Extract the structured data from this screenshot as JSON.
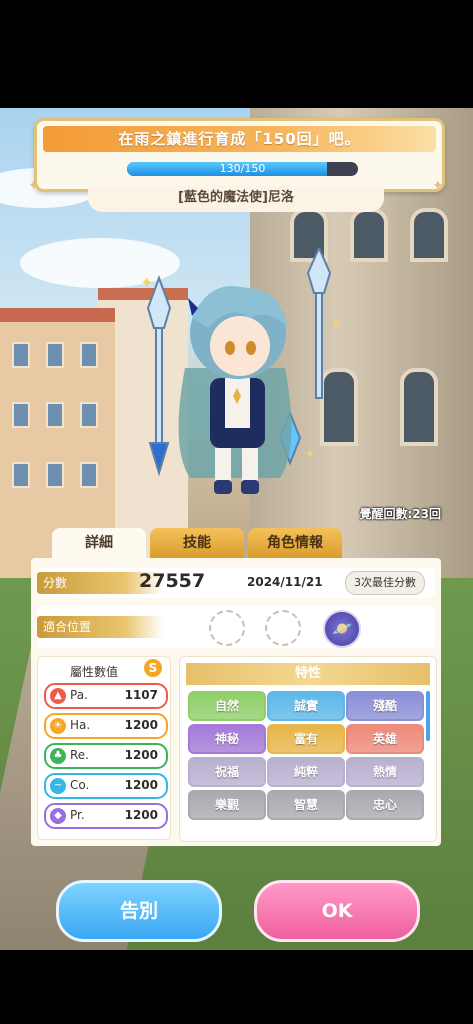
{
  "banner": {
    "goal_text": "在雨之鎮進行育成「150回」吧。",
    "progress_text": "130/150",
    "progress_value": 130,
    "progress_max": 150
  },
  "character": {
    "title": "[藍色的魔法使]尼洛",
    "awakening_text": "覺醒回數:23回"
  },
  "tabs": [
    {
      "label": "詳細"
    },
    {
      "label": "技能"
    },
    {
      "label": "角色情報"
    }
  ],
  "details": {
    "score_label": "分數",
    "score_value": "27557",
    "date": "2024/11/21",
    "best_score_button": "3次最佳分數",
    "position_label": "適合位置"
  },
  "attributes": {
    "title": "屬性數值",
    "badge": "S",
    "stats": [
      {
        "name": "Pa.",
        "value": "1107",
        "icon": "fire-icon",
        "color": "#ef5b4a"
      },
      {
        "name": "Ha.",
        "value": "1200",
        "icon": "sun-icon",
        "color": "#f5a623"
      },
      {
        "name": "Re.",
        "value": "1200",
        "icon": "clover-icon",
        "color": "#3cb55a"
      },
      {
        "name": "Co.",
        "value": "1200",
        "icon": "wave-icon",
        "color": "#35b6e8"
      },
      {
        "name": "Pr.",
        "value": "1200",
        "icon": "diamond-icon",
        "color": "#9b6ee0"
      }
    ]
  },
  "traits": {
    "title": "特性",
    "items": [
      {
        "label": "自然",
        "color": "#8fcf6a"
      },
      {
        "label": "誠實",
        "color": "#5db8e8"
      },
      {
        "label": "殘酷",
        "color": "#8b8fd6"
      },
      {
        "label": "神秘",
        "color": "#a57ad8"
      },
      {
        "label": "富有",
        "color": "#e8b54a"
      },
      {
        "label": "英雄",
        "color": "#ee8a7a"
      },
      {
        "label": "祝福",
        "color": "#b9b0cf"
      },
      {
        "label": "純粹",
        "color": "#b9b0cf"
      },
      {
        "label": "熱情",
        "color": "#b9b0cf"
      },
      {
        "label": "樂觀",
        "color": "#a9a9b0"
      },
      {
        "label": "智慧",
        "color": "#a9a9b0"
      },
      {
        "label": "忠心",
        "color": "#a9a9b0"
      }
    ]
  },
  "buttons": {
    "cancel": "告別",
    "ok": "OK"
  }
}
